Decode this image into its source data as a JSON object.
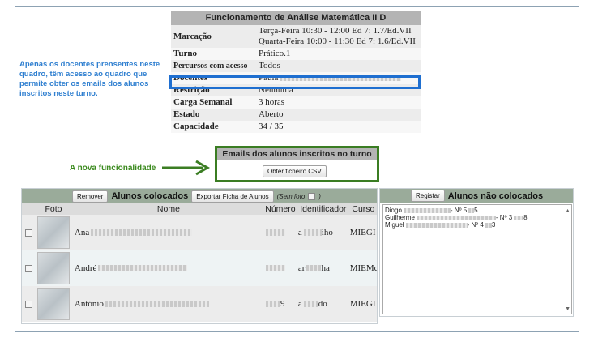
{
  "info": {
    "title": "Funcionamento de Análise Matemática II D",
    "rows": [
      {
        "key": "Marcação",
        "values": [
          "Terça-Feira  10:30 - 12:00  Ed 7: 1.7/Ed.VII",
          "Quarta-Feira  10:00 - 11:30  Ed 7: 1.6/Ed.VII"
        ]
      },
      {
        "key": "Turno",
        "values": [
          "Prático.1"
        ]
      },
      {
        "key": "Percursos com acesso",
        "values": [
          "Todos"
        ]
      },
      {
        "key": "Docentes",
        "values": [
          "Paula"
        ]
      },
      {
        "key": "Restrição",
        "values": [
          "Nenhuma"
        ]
      },
      {
        "key": "Carga Semanal",
        "values": [
          "3 horas"
        ]
      },
      {
        "key": "Estado",
        "values": [
          "Aberto"
        ]
      },
      {
        "key": "Capacidade",
        "values": [
          "34 / 35"
        ]
      }
    ]
  },
  "notes": {
    "left": "Apenas os docentes prensentes neste quadro, têm acesso ao quadro que permite obter os emails dos alunos inscritos neste turno.",
    "new_feature": "A nova funcionalidade"
  },
  "emails": {
    "title": "Emails dos alunos inscritos no turno",
    "button": "Obter ficheiro CSV"
  },
  "placed": {
    "remove_button": "Remover",
    "title": "Alunos colocados",
    "export_button": "Exportar Ficha de Alunos",
    "hint": "(Sem foto",
    "hint_end": ")",
    "columns": [
      "Foto",
      "Nome",
      "Número",
      "Identificador",
      "Curso"
    ],
    "rows": [
      {
        "name": "Ana",
        "number": "",
        "id_start": "a",
        "id_end": "iho",
        "course": "MIEGI"
      },
      {
        "name": "André",
        "number": "",
        "id_start": "ar",
        "id_end": "ha",
        "course": "MIEMc"
      },
      {
        "name": "António",
        "number": "9",
        "id_start": "a",
        "id_end": "do",
        "course": "MIEGI"
      }
    ]
  },
  "unplaced": {
    "register_button": "Registar",
    "title": "Alunos não colocados",
    "items": [
      {
        "start": "Diogo",
        "end": "- Nº 5",
        "tail": "5"
      },
      {
        "start": "Guilherme",
        "end": "- Nº 3",
        "tail": "8"
      },
      {
        "start": "Miguel",
        "end": "- Nº 4",
        "tail": "3"
      }
    ]
  },
  "colors": {
    "highlight_blue": "#1f6fd0",
    "highlight_green": "#3b7d23",
    "note_blue": "#2f7fd0",
    "header_green": "#9aab9a"
  }
}
